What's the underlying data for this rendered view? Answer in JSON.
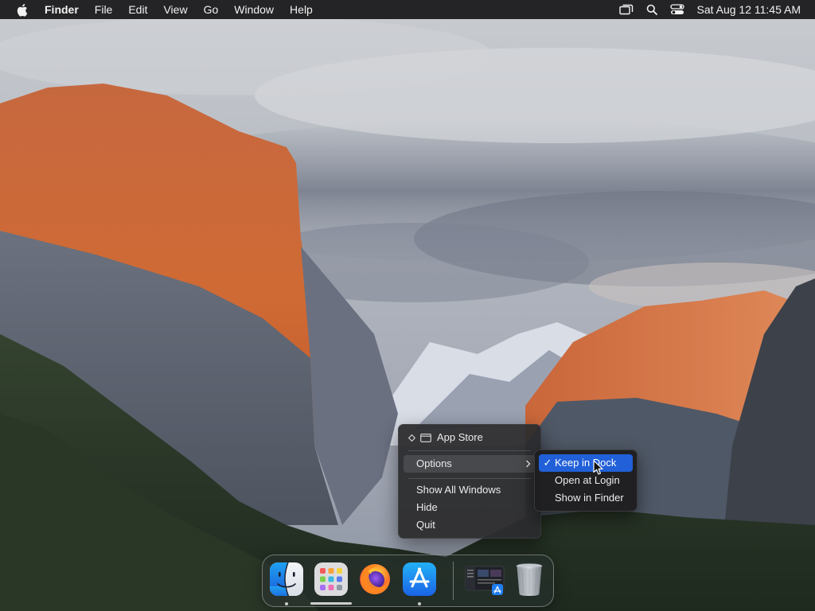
{
  "menubar": {
    "app_name": "Finder",
    "menus": [
      "File",
      "Edit",
      "View",
      "Go",
      "Window",
      "Help"
    ],
    "status_icons": [
      "screen-mirroring-icon",
      "search-icon",
      "control-center-icon"
    ],
    "clock": "Sat Aug 12  11:45 AM"
  },
  "context_menu": {
    "header_label": "App Store",
    "options_label": "Options",
    "items": [
      "Show All Windows",
      "Hide",
      "Quit"
    ]
  },
  "submenu": {
    "items": [
      {
        "label": "Keep in Dock",
        "checked": true,
        "selected": true
      },
      {
        "label": "Open at Login",
        "checked": false,
        "selected": false
      },
      {
        "label": "Show in Finder",
        "checked": false,
        "selected": false
      }
    ],
    "check_glyph": "✓"
  },
  "dock": {
    "apps": [
      "finder-icon",
      "launchpad-icon",
      "firefox-icon",
      "app-store-icon",
      "app-store-window-thumbnail",
      "trash-icon"
    ],
    "running": [
      "finder-icon",
      "app-store-icon"
    ]
  },
  "colors": {
    "menubar_bg": "#161618",
    "selection_blue": "#2160d8",
    "menu_bg": "#2c2c2e"
  }
}
